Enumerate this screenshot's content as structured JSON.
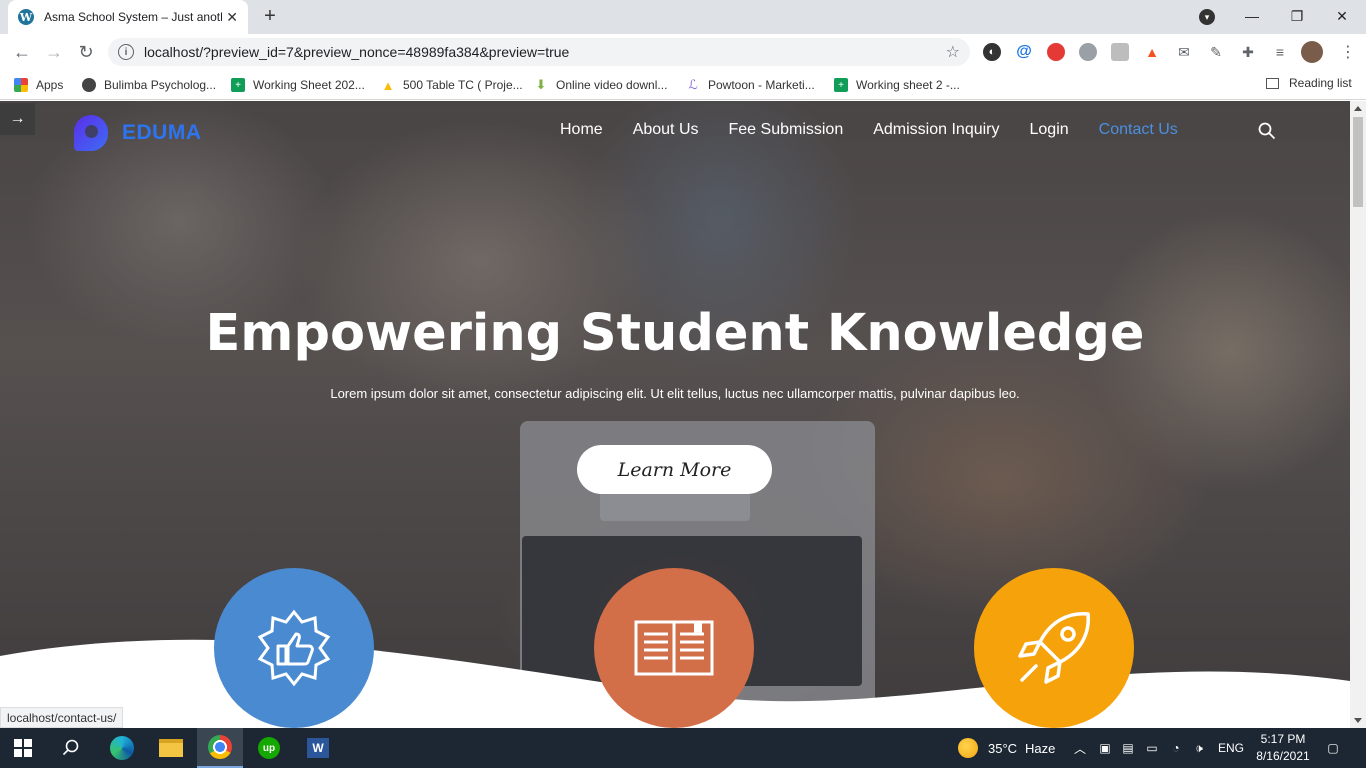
{
  "browser": {
    "tab_title": "Asma School System – Just anoth",
    "url": "localhost/?preview_id=7&preview_nonce=48989fa384&preview=true",
    "bookmarks": [
      {
        "label": "Apps",
        "icon": "apps-grid-icon"
      },
      {
        "label": "Bulimba Psycholog...",
        "icon": "globe-icon"
      },
      {
        "label": "Working Sheet 202...",
        "icon": "sheets-icon"
      },
      {
        "label": "500 Table TC ( Proje...",
        "icon": "drive-icon"
      },
      {
        "label": "Online video downl...",
        "icon": "download-icon"
      },
      {
        "label": "Powtoon - Marketi...",
        "icon": "powtoon-icon"
      },
      {
        "label": "Working sheet 2 -...",
        "icon": "sheets-icon"
      }
    ],
    "reading_list": "Reading list"
  },
  "site": {
    "logo_text": "EDUMA",
    "nav": [
      "Home",
      "About Us",
      "Fee Submission",
      "Admission Inquiry",
      "Login",
      "Contact Us"
    ],
    "active_nav": "Contact Us",
    "headline": "Empowering Student Knowledge",
    "subline": "Lorem ipsum dolor sit amet, consectetur adipiscing elit. Ut elit tellus, luctus nec ullamcorper mattis, pulvinar dapibus leo.",
    "cta": "Learn More",
    "features": [
      {
        "icon": "thumbs-up-badge-icon",
        "color": "#4a8ad0"
      },
      {
        "icon": "open-book-icon",
        "color": "#d26e48"
      },
      {
        "icon": "rocket-icon",
        "color": "#f6a20a"
      }
    ],
    "status_link": "localhost/contact-us/"
  },
  "taskbar": {
    "temperature": "35°C",
    "weather": "Haze",
    "language": "ENG",
    "time": "5:17 PM",
    "date": "8/16/2021"
  }
}
